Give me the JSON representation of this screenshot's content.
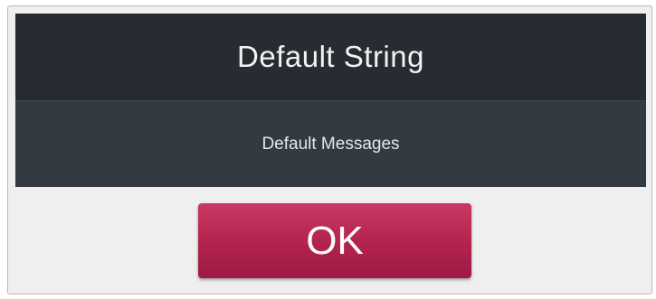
{
  "dialog": {
    "title": "Default String",
    "message": "Default Messages",
    "ok_label": "OK"
  },
  "colors": {
    "header_bg": "#272c33",
    "body_bg": "#333a42",
    "dialog_bg": "#efefef",
    "button_bg": "#b42450",
    "text_light": "#f2f2f2"
  }
}
